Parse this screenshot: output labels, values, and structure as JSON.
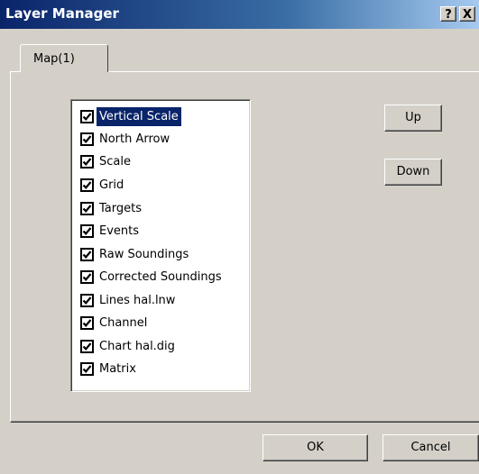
{
  "window": {
    "title": "Layer Manager",
    "help_label": "?",
    "close_label": "X"
  },
  "tabs": [
    {
      "label": "Map(1)"
    }
  ],
  "layers": {
    "items": [
      {
        "label": "Vertical Scale",
        "checked": true,
        "selected": true
      },
      {
        "label": "North Arrow",
        "checked": true,
        "selected": false
      },
      {
        "label": "Scale",
        "checked": true,
        "selected": false
      },
      {
        "label": "Grid",
        "checked": true,
        "selected": false
      },
      {
        "label": "Targets",
        "checked": true,
        "selected": false
      },
      {
        "label": "Events",
        "checked": true,
        "selected": false
      },
      {
        "label": "Raw Soundings",
        "checked": true,
        "selected": false
      },
      {
        "label": "Corrected Soundings",
        "checked": true,
        "selected": false
      },
      {
        "label": "Lines hal.lnw",
        "checked": true,
        "selected": false
      },
      {
        "label": "Channel",
        "checked": true,
        "selected": false
      },
      {
        "label": "Chart hal.dig",
        "checked": true,
        "selected": false
      },
      {
        "label": "Matrix",
        "checked": true,
        "selected": false
      }
    ]
  },
  "buttons": {
    "up": "Up",
    "down": "Down",
    "ok": "OK",
    "cancel": "Cancel"
  }
}
